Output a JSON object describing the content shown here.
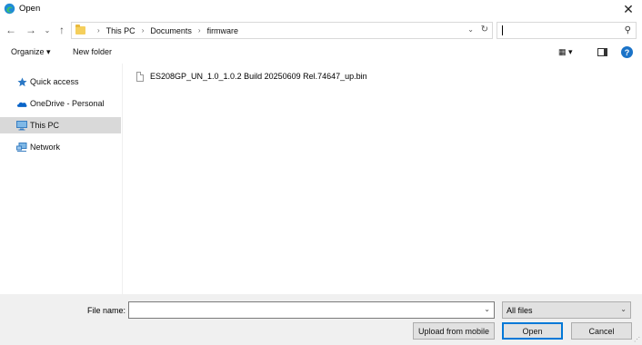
{
  "window": {
    "title": "Open",
    "app_icon": "edge-browser-icon",
    "close_icon": "close-icon"
  },
  "nav": {
    "back_icon": "arrow-left-icon",
    "forward_icon": "arrow-right-icon",
    "recent_icon": "chevron-down-icon",
    "up_icon": "arrow-up-icon",
    "breadcrumb": [
      "This PC",
      "Documents",
      "firmware"
    ],
    "search_placeholder": ""
  },
  "toolbar": {
    "organize_label": "Organize ▾",
    "new_folder_label": "New folder",
    "view_label": "▦ ▾"
  },
  "sidebar": {
    "items": [
      {
        "label": "Quick access",
        "icon": "star-icon",
        "color": "#2b78c5"
      },
      {
        "label": "OneDrive - Personal",
        "icon": "cloud-icon",
        "color": "#0a64c8"
      },
      {
        "label": "This PC",
        "icon": "monitor-icon",
        "color": "#3a7fc2",
        "selected": true
      },
      {
        "label": "Network",
        "icon": "network-icon",
        "color": "#3a7fc2"
      }
    ]
  },
  "files": [
    {
      "name": "ES208GP_UN_1.0_1.0.2 Build 20250609 Rel.74647_up.bin"
    }
  ],
  "footer": {
    "file_name_label": "File name:",
    "file_name_value": "",
    "file_type_value": "All files",
    "upload_label": "Upload from mobile",
    "open_label": "Open",
    "cancel_label": "Cancel"
  },
  "colors": {
    "accent": "#0078d7",
    "selection": "#d9d9d9",
    "footer_bg": "#f0f0f0"
  }
}
